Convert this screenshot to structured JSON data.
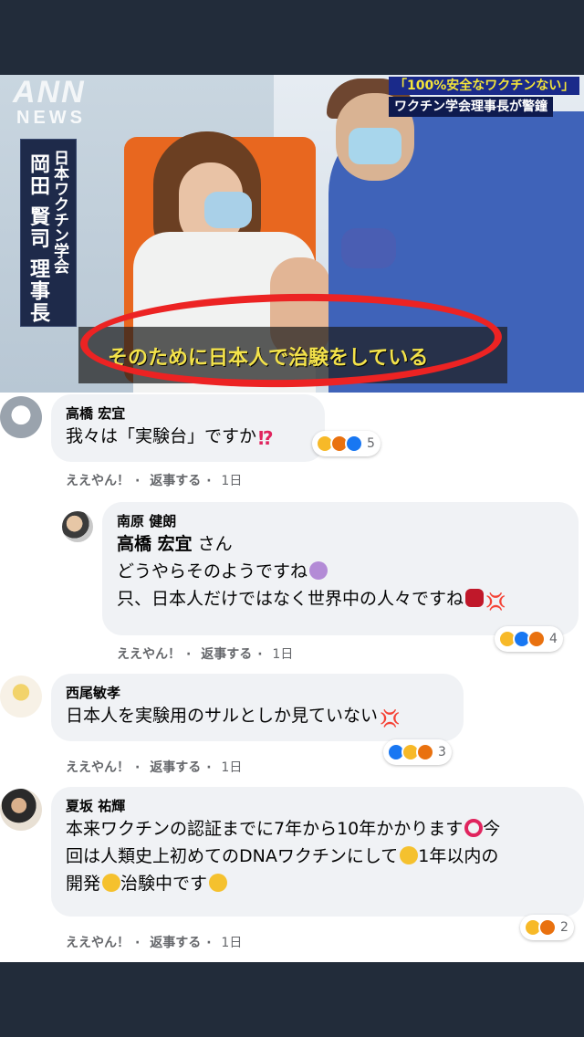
{
  "news": {
    "ann_logo": "ANN",
    "news_logo": "NEWS",
    "org_vertical": "日本ワクチン学会",
    "name_vertical": "岡田 賢司 理事長",
    "headline": "「100%安全なワクチンない」",
    "subhead": "ワクチン学会理事長が警鐘",
    "subtitle": "そのために日本人で治験をしている"
  },
  "comments": [
    {
      "author": "高橋 宏宜",
      "text": "我々は「実験台」ですか",
      "inline_icon": "⁉",
      "reactions": [
        "sad",
        "angry",
        "like"
      ],
      "reaction_count": "5",
      "like": "ええやん！",
      "reply": "返事する",
      "time": "1日"
    },
    {
      "author": "南原 健朗",
      "mention": "高橋 宏宜",
      "mention_suffix": " さん",
      "line1": "どうやらそのようですね",
      "line2": "只、日本人だけではなく世界中の人々ですね",
      "reactions": [
        "sad",
        "like",
        "angry"
      ],
      "reaction_count": "4",
      "like": "ええやん！",
      "reply": "返事する",
      "time": "1日"
    },
    {
      "author": "西尾敏孝",
      "text": "日本人を実験用のサルとしか見ていない",
      "reactions": [
        "like",
        "sad",
        "angry"
      ],
      "reaction_count": "3",
      "like": "ええやん！",
      "reply": "返事する",
      "time": "1日"
    },
    {
      "author": "夏坂 祐輝",
      "line1": "本来ワクチンの認証までに7年から10年かかります",
      "line1b": "今",
      "line2": "回は人類史上初めてのDNAワクチンにして",
      "line2b": "1年以内の",
      "line3a": "開発",
      "line3b": "治験中です",
      "reactions": [
        "sad",
        "angry"
      ],
      "reaction_count": "2",
      "like": "ええやん！",
      "reply": "返事する",
      "time": "1日"
    }
  ],
  "colors": {
    "bubble": "#f0f2f5",
    "meta_text": "#65676b",
    "red_circle": "#ec2323",
    "subtitle_yellow": "#f3e24a"
  }
}
